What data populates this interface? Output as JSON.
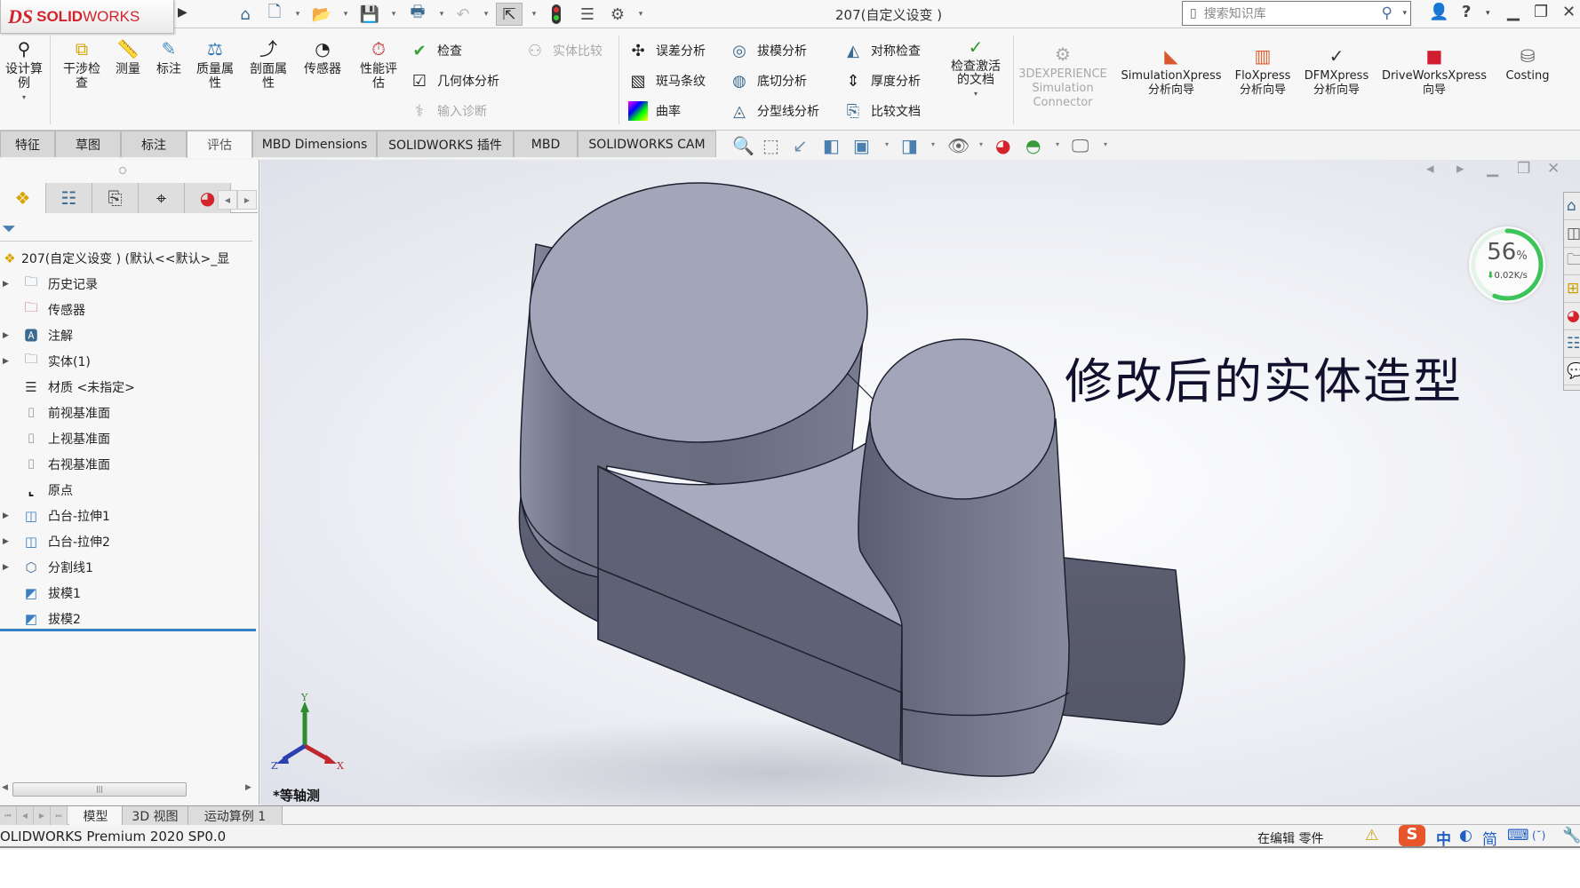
{
  "app": {
    "brand_mark": "DS",
    "brand_bold": "SOLID",
    "brand_light": "WORKS",
    "document_title": "207(自定义设变 )"
  },
  "quick_access": [
    {
      "name": "home-icon",
      "glyph": "⌂"
    },
    {
      "name": "new-document-icon",
      "glyph": "🗋"
    },
    {
      "name": "open-icon",
      "glyph": "📂"
    },
    {
      "name": "save-icon",
      "glyph": "💾"
    },
    {
      "name": "print-icon",
      "glyph": "🖶"
    },
    {
      "name": "undo-icon",
      "glyph": "↶"
    },
    {
      "name": "select-cursor-icon",
      "glyph": "⇱"
    },
    {
      "name": "rebuild-icon",
      "glyph": "🚦"
    },
    {
      "name": "file-properties-icon",
      "glyph": "☰"
    },
    {
      "name": "options-gear-icon",
      "glyph": "⚙"
    }
  ],
  "search": {
    "placeholder": "搜索知识库"
  },
  "window_controls": {
    "user": "👤",
    "help": "?",
    "minimize": "▁",
    "restore": "❐",
    "close": "✕"
  },
  "ribbon": {
    "large_buttons": [
      {
        "label": "设计算\n例",
        "icon": "design-study-icon",
        "glyph": "⚲"
      },
      {
        "label": "干涉检\n查",
        "icon": "interference-check-icon",
        "glyph": "⧉"
      },
      {
        "label": "测量",
        "icon": "measure-icon",
        "glyph": "📏"
      },
      {
        "label": "标注",
        "icon": "markup-icon",
        "glyph": "✎"
      },
      {
        "label": "质量属\n性",
        "icon": "mass-properties-icon",
        "glyph": "⚖"
      },
      {
        "label": "剖面属\n性",
        "icon": "section-properties-icon",
        "glyph": "⤴"
      },
      {
        "label": "传感器",
        "icon": "sensor-icon",
        "glyph": "◔"
      },
      {
        "label": "性能评\n估",
        "icon": "performance-evaluation-icon",
        "glyph": "⏱"
      }
    ],
    "small_buttons": [
      {
        "label": "检查",
        "icon": "check-icon",
        "glyph": "✔",
        "disabled": false
      },
      {
        "label": "几何体分析",
        "icon": "geometry-analysis-icon",
        "glyph": "☑",
        "disabled": false
      },
      {
        "label": "输入诊断",
        "icon": "import-diagnostics-icon",
        "glyph": "⚕",
        "disabled": true
      },
      {
        "label": "实体比较",
        "icon": "compare-bodies-icon",
        "glyph": "⚇",
        "disabled": true
      },
      {
        "label": "误差分析",
        "icon": "deviation-analysis-icon",
        "glyph": "✣",
        "disabled": false
      },
      {
        "label": "斑马条纹",
        "icon": "zebra-stripes-icon",
        "glyph": "▧",
        "disabled": false
      },
      {
        "label": "曲率",
        "icon": "curvature-icon",
        "glyph": "■",
        "disabled": false
      },
      {
        "label": "拔模分析",
        "icon": "draft-analysis-icon",
        "glyph": "◎",
        "disabled": false
      },
      {
        "label": "底切分析",
        "icon": "undercut-analysis-icon",
        "glyph": "◍",
        "disabled": false
      },
      {
        "label": "分型线分析",
        "icon": "parting-line-analysis-icon",
        "glyph": "◬",
        "disabled": false
      },
      {
        "label": "对称检查",
        "icon": "symmetry-check-icon",
        "glyph": "◭",
        "disabled": false
      },
      {
        "label": "厚度分析",
        "icon": "thickness-analysis-icon",
        "glyph": "⇕",
        "disabled": false
      },
      {
        "label": "比较文档",
        "icon": "compare-documents-icon",
        "glyph": "⎘",
        "disabled": false
      }
    ],
    "check_active": {
      "label": "检查激活\n的文档",
      "icon": "check-active-document-icon",
      "glyph": "✓"
    },
    "addins": [
      {
        "label": "3DEXPERIENCE\nSimulation\nConnector",
        "icon": "3dexperience-icon",
        "glyph": "⚙",
        "disabled": true
      },
      {
        "label": "SimulationXpress\n分析向导",
        "icon": "simulationxpress-icon",
        "glyph": "◣",
        "disabled": false
      },
      {
        "label": "FloXpress\n分析向导",
        "icon": "floxpress-icon",
        "glyph": "▥",
        "disabled": false
      },
      {
        "label": "DFMXpress\n分析向导",
        "icon": "dfmxpress-icon",
        "glyph": "✓",
        "disabled": false
      },
      {
        "label": "DriveWorksXpress\n向导",
        "icon": "driveworksxpress-icon",
        "glyph": "■",
        "disabled": false
      },
      {
        "label": "Costing",
        "icon": "costing-icon",
        "glyph": "⛁",
        "disabled": false
      }
    ]
  },
  "tabs": [
    {
      "label": "特征",
      "active": false
    },
    {
      "label": "草图",
      "active": false
    },
    {
      "label": "标注",
      "active": false
    },
    {
      "label": "评估",
      "active": true
    },
    {
      "label": "MBD Dimensions",
      "active": false
    },
    {
      "label": "SOLIDWORKS 插件",
      "active": false
    },
    {
      "label": "MBD",
      "active": false
    },
    {
      "label": "SOLIDWORKS CAM",
      "active": false
    }
  ],
  "heads_up": [
    {
      "name": "zoom-to-fit-icon",
      "glyph": "🔍"
    },
    {
      "name": "zoom-to-area-icon",
      "glyph": "⬚"
    },
    {
      "name": "previous-view-icon",
      "glyph": "↙"
    },
    {
      "name": "section-view-icon",
      "glyph": "◧"
    },
    {
      "name": "view-orientation-icon",
      "glyph": "▣"
    },
    {
      "name": "display-style-icon",
      "glyph": "◨"
    },
    {
      "name": "hide-show-items-icon",
      "glyph": "👁"
    },
    {
      "name": "edit-appearance-icon",
      "glyph": "◕"
    },
    {
      "name": "apply-scene-icon",
      "glyph": "◓"
    },
    {
      "name": "view-settings-icon",
      "glyph": "🖵"
    }
  ],
  "sidebar": {
    "panel_tabs": [
      {
        "name": "featuremanager-tab",
        "glyph": "❖"
      },
      {
        "name": "propertymanager-tab",
        "glyph": "☷"
      },
      {
        "name": "configurationmanager-tab",
        "glyph": "⎘"
      },
      {
        "name": "dimxpertmanager-tab",
        "glyph": "⌖"
      },
      {
        "name": "displaymanager-tab",
        "glyph": "◕"
      }
    ],
    "filter_icon": "⏷",
    "root": {
      "label": "207(自定义设变 )  (默认<<默认>_显",
      "glyph": "❖"
    },
    "items": [
      {
        "label": "历史记录",
        "icon": "history-folder-icon",
        "glyph": "🗀",
        "expandable": true
      },
      {
        "label": "传感器",
        "icon": "sensors-folder-icon",
        "glyph": "🗀",
        "expandable": false
      },
      {
        "label": "注解",
        "icon": "annotations-folder-icon",
        "glyph": "🅰",
        "expandable": true
      },
      {
        "label": "实体(1)",
        "icon": "solid-bodies-folder-icon",
        "glyph": "🗀",
        "expandable": true
      },
      {
        "label": "材质 <未指定>",
        "icon": "material-icon",
        "glyph": "☰",
        "expandable": false
      },
      {
        "label": "前视基准面",
        "icon": "plane-icon",
        "glyph": "⌷",
        "expandable": false
      },
      {
        "label": "上视基准面",
        "icon": "plane-icon",
        "glyph": "⌷",
        "expandable": false
      },
      {
        "label": "右视基准面",
        "icon": "plane-icon",
        "glyph": "⌷",
        "expandable": false
      },
      {
        "label": "原点",
        "icon": "origin-icon",
        "glyph": "⌞",
        "expandable": false
      },
      {
        "label": "凸台-拉伸1",
        "icon": "boss-extrude-icon",
        "glyph": "◫",
        "expandable": true
      },
      {
        "label": "凸台-拉伸2",
        "icon": "boss-extrude-icon",
        "glyph": "◫",
        "expandable": true
      },
      {
        "label": "分割线1",
        "icon": "split-line-icon",
        "glyph": "⬡",
        "expandable": true
      },
      {
        "label": "拔模1",
        "icon": "draft-icon",
        "glyph": "◩",
        "expandable": false
      },
      {
        "label": "拔模2",
        "icon": "draft-icon",
        "glyph": "◩",
        "expandable": false
      }
    ]
  },
  "viewport": {
    "caption": "修改后的实体造型",
    "view_name": "*等轴测",
    "triad": {
      "x": "X",
      "y": "Y",
      "z": "Z"
    },
    "net_monitor": {
      "percent": 56,
      "percent_label": "56",
      "percent_unit": "%",
      "rate": "0.02K/s",
      "arrow": "⬇"
    },
    "taskpane": [
      "⌂",
      "◫",
      "🗀",
      "⊞",
      "◕",
      "☷",
      "💬"
    ],
    "doc_controls": [
      "◂",
      "▸",
      "▁",
      "❐",
      "✕"
    ]
  },
  "bottom_tabs": [
    {
      "label": "模型",
      "active": true
    },
    {
      "label": "3D 视图",
      "active": false
    },
    {
      "label": "运动算例 1",
      "active": false
    }
  ],
  "status_bar": {
    "product": "OLIDWORKS Premium 2020 SP0.0",
    "editing": "在编辑 零件",
    "ime": [
      "S",
      "中",
      "◐",
      "简",
      "⌨",
      "(˘)",
      "🔧"
    ]
  },
  "colors": {
    "brand_red": "#d3242c",
    "model_top": "#a3a6b9",
    "model_side_dark": "#5c5f70",
    "model_side_light": "#8a8da0",
    "tree_selection_bar": "#3a7fc1",
    "progress_green": "#3cc45a"
  }
}
